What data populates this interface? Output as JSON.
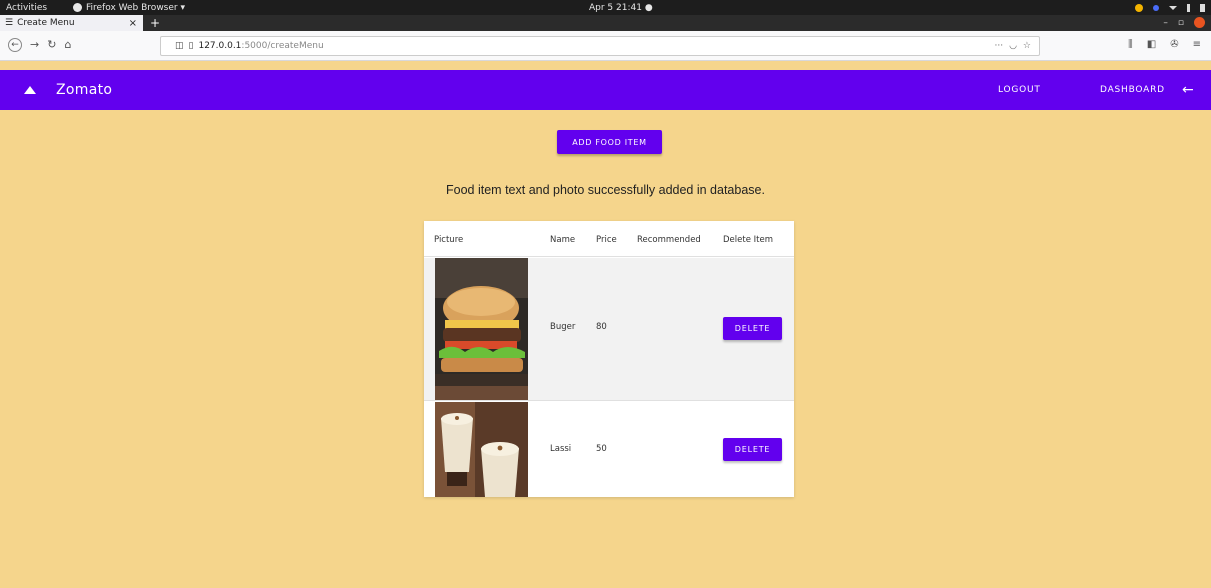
{
  "system_bar": {
    "activities": "Activities",
    "app_name": "Firefox Web Browser ▾",
    "clock": "Apr 5  21:41  ●"
  },
  "browser": {
    "tab_title": "Create Menu",
    "url_host": "127.0.0.1",
    "url_path": ":5000/createMenu"
  },
  "appbar": {
    "brand": "Zomato",
    "logout_label": "LOGOUT",
    "dashboard_label": "DASHBOARD",
    "color": "#6200ee"
  },
  "main": {
    "add_button_label": "ADD FOOD ITEM",
    "message": "Food item text and photo successfully added in database.",
    "background": "#f5d58c"
  },
  "table": {
    "headers": [
      "Picture",
      "Name",
      "Price",
      "Recommended",
      "Delete Item"
    ],
    "rows": [
      {
        "picture": "burger-photo",
        "name": "Buger",
        "price": "80",
        "recommended": "",
        "delete_label": "DELETE"
      },
      {
        "picture": "lassi-photo",
        "name": "Lassi",
        "price": "50",
        "recommended": "",
        "delete_label": "DELETE"
      }
    ]
  }
}
